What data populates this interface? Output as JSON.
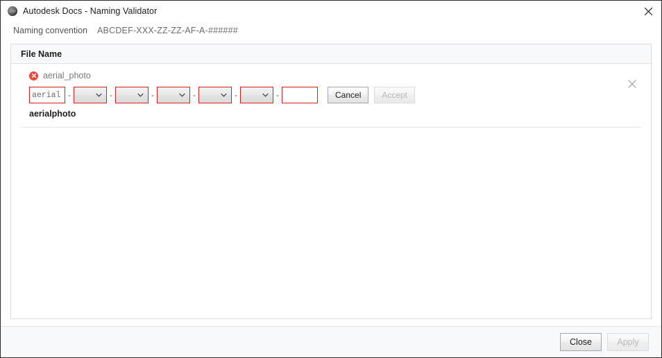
{
  "window": {
    "title": "Autodesk Docs - Naming Validator",
    "app_icon": "autodesk-globe-icon",
    "close_icon": "close-icon"
  },
  "convention": {
    "label": "Naming convention",
    "value": "ABCDEF-XXX-ZZ-ZZ-AF-A-######"
  },
  "panel": {
    "header_title": "File Name"
  },
  "entry": {
    "status_icon": "error-icon",
    "status_color": "#e8483a",
    "filename": "aerial_photo",
    "result_name": "aerialphoto",
    "dismiss_icon": "close-icon",
    "separator": "-",
    "fields": [
      {
        "type": "text",
        "value": "aerial",
        "placeholder": "",
        "name": "segment-1-input"
      },
      {
        "type": "select",
        "value": "",
        "name": "segment-2-select"
      },
      {
        "type": "select",
        "value": "",
        "name": "segment-3-select"
      },
      {
        "type": "select",
        "value": "",
        "name": "segment-4-select"
      },
      {
        "type": "select",
        "value": "",
        "name": "segment-5-select"
      },
      {
        "type": "select",
        "value": "",
        "name": "segment-6-select"
      },
      {
        "type": "text",
        "value": "",
        "placeholder": "",
        "name": "segment-7-input"
      }
    ],
    "cancel_label": "Cancel",
    "accept_label": "Accept",
    "accept_disabled": true
  },
  "footer": {
    "close_label": "Close",
    "apply_label": "Apply",
    "apply_disabled": true
  }
}
